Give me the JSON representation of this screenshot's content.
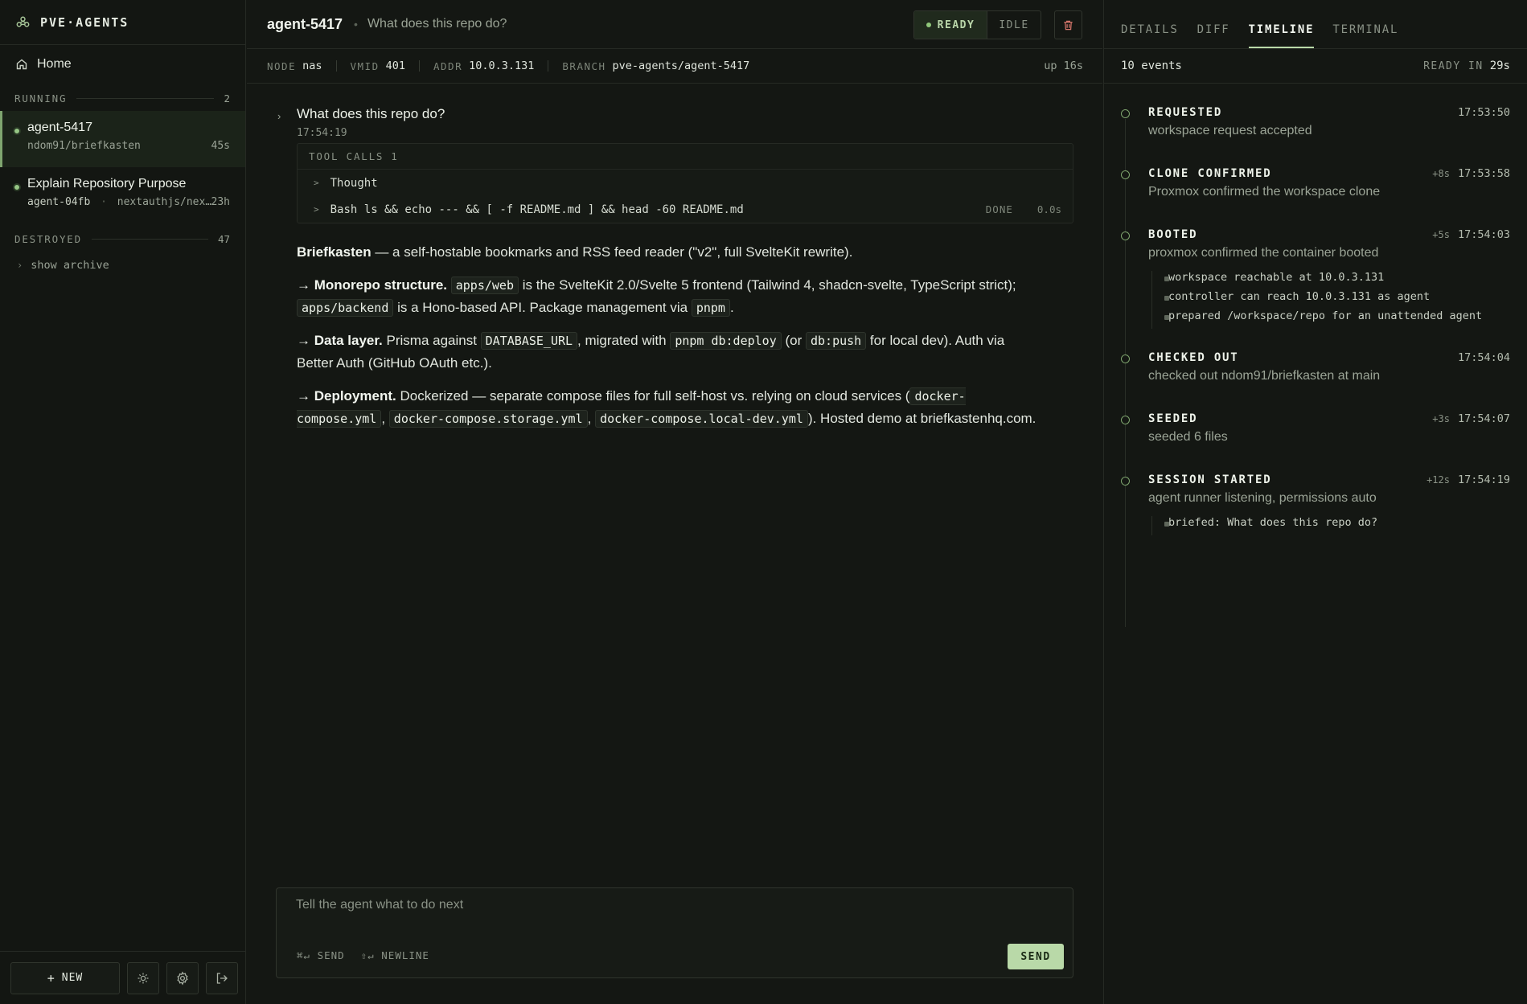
{
  "brand": {
    "name": "PVE·AGENTS"
  },
  "nav": {
    "home_label": "Home"
  },
  "running": {
    "label": "RUNNING",
    "count": "2",
    "items": [
      {
        "name": "agent-5417",
        "repo": "ndom91/briefkasten",
        "age": "45s"
      },
      {
        "name": "Explain Repository Purpose",
        "agent": "agent-04fb",
        "repo": "nextauthjs/nex…",
        "age": "23h"
      }
    ]
  },
  "destroyed": {
    "label": "DESTROYED",
    "count": "47",
    "archive_label": "show archive"
  },
  "sidebar_bottom": {
    "new_label": "NEW"
  },
  "header": {
    "agent_name": "agent-5417",
    "prompt": "What does this repo do?",
    "status_ready": "READY",
    "status_idle": "IDLE"
  },
  "meta": {
    "node_label": "NODE",
    "node": "nas",
    "vmid_label": "VMID",
    "vmid": "401",
    "addr_label": "ADDR",
    "addr": "10.0.3.131",
    "branch_label": "BRANCH",
    "branch": "pve-agents/agent-5417",
    "uptime": "up 16s"
  },
  "conversation": {
    "question": "What does this repo do?",
    "time": "17:54:19",
    "tool_calls_label": "TOOL CALLS",
    "tool_calls_count": "1",
    "tools": [
      {
        "name": "Thought",
        "status": "",
        "duration": ""
      },
      {
        "name": "Bash ls && echo --- && [ -f README.md ] && head -60 README.md",
        "status": "DONE",
        "duration": "0.0s"
      }
    ],
    "answer": {
      "p1_bold": "Briefkasten",
      "p1_rest": " — a self-hostable bookmarks and RSS feed reader (\"v2\", full SvelteKit rewrite).",
      "p2_bold": "→ Monorepo structure.",
      "p2_code1": "apps/web",
      "p2_t1": " is the SvelteKit 2.0/Svelte 5 frontend (Tailwind 4, shadcn-svelte, TypeScript strict); ",
      "p2_code2": "apps/backend",
      "p2_t2": " is a Hono-based API. Package management via ",
      "p2_code3": "pnpm",
      "p2_t3": ".",
      "p3_bold": "→ Data layer.",
      "p3_t1": " Prisma against ",
      "p3_code1": "DATABASE_URL",
      "p3_t2": ", migrated with ",
      "p3_code2": "pnpm db:deploy",
      "p3_t3": " (or ",
      "p3_code3": "db:push",
      "p3_t4": " for local dev). Auth via Better Auth (GitHub OAuth etc.).",
      "p4_bold": "→ Deployment.",
      "p4_t1": " Dockerized — separate compose files for full self-host vs. relying on cloud services (",
      "p4_code1": "docker-compose.yml",
      "p4_t2": ", ",
      "p4_code2": "docker-compose.storage.yml",
      "p4_t3": ", ",
      "p4_code3": "docker-compose.local-dev.yml",
      "p4_t4": "). Hosted demo at briefkastenhq.com."
    }
  },
  "composer": {
    "placeholder": "Tell the agent what to do next",
    "hint_send": "⌘↵ SEND",
    "hint_newline": "⇧↵ NEWLINE",
    "send_label": "SEND"
  },
  "panel": {
    "tabs": [
      "DETAILS",
      "DIFF",
      "TIMELINE",
      "TERMINAL"
    ],
    "active_tab": "TIMELINE",
    "events_count": "10 events",
    "ready_in_label": "READY IN",
    "ready_in_value": "29s",
    "events": [
      {
        "title": "REQUESTED",
        "delta": "",
        "time": "17:53:50",
        "desc": "workspace request accepted",
        "details": []
      },
      {
        "title": "CLONE CONFIRMED",
        "delta": "+8s",
        "time": "17:53:58",
        "desc": "Proxmox confirmed the workspace clone",
        "details": []
      },
      {
        "title": "BOOTED",
        "delta": "+5s",
        "time": "17:54:03",
        "desc": "proxmox confirmed the container booted",
        "details": [
          "workspace reachable at 10.0.3.131",
          "controller can reach 10.0.3.131 as agent",
          "prepared /workspace/repo for an unattended agent"
        ]
      },
      {
        "title": "CHECKED OUT",
        "delta": "",
        "time": "17:54:04",
        "desc": "checked out ndom91/briefkasten at main",
        "details": []
      },
      {
        "title": "SEEDED",
        "delta": "+3s",
        "time": "17:54:07",
        "desc": "seeded 6 files",
        "details": []
      },
      {
        "title": "SESSION STARTED",
        "delta": "+12s",
        "time": "17:54:19",
        "desc": "agent runner listening, permissions auto",
        "details": [
          "briefed: What does this repo do?"
        ]
      }
    ]
  },
  "colors": {
    "accent": "#b9d9a8",
    "ready_dot": "#8fc77a",
    "background": "#141713"
  }
}
